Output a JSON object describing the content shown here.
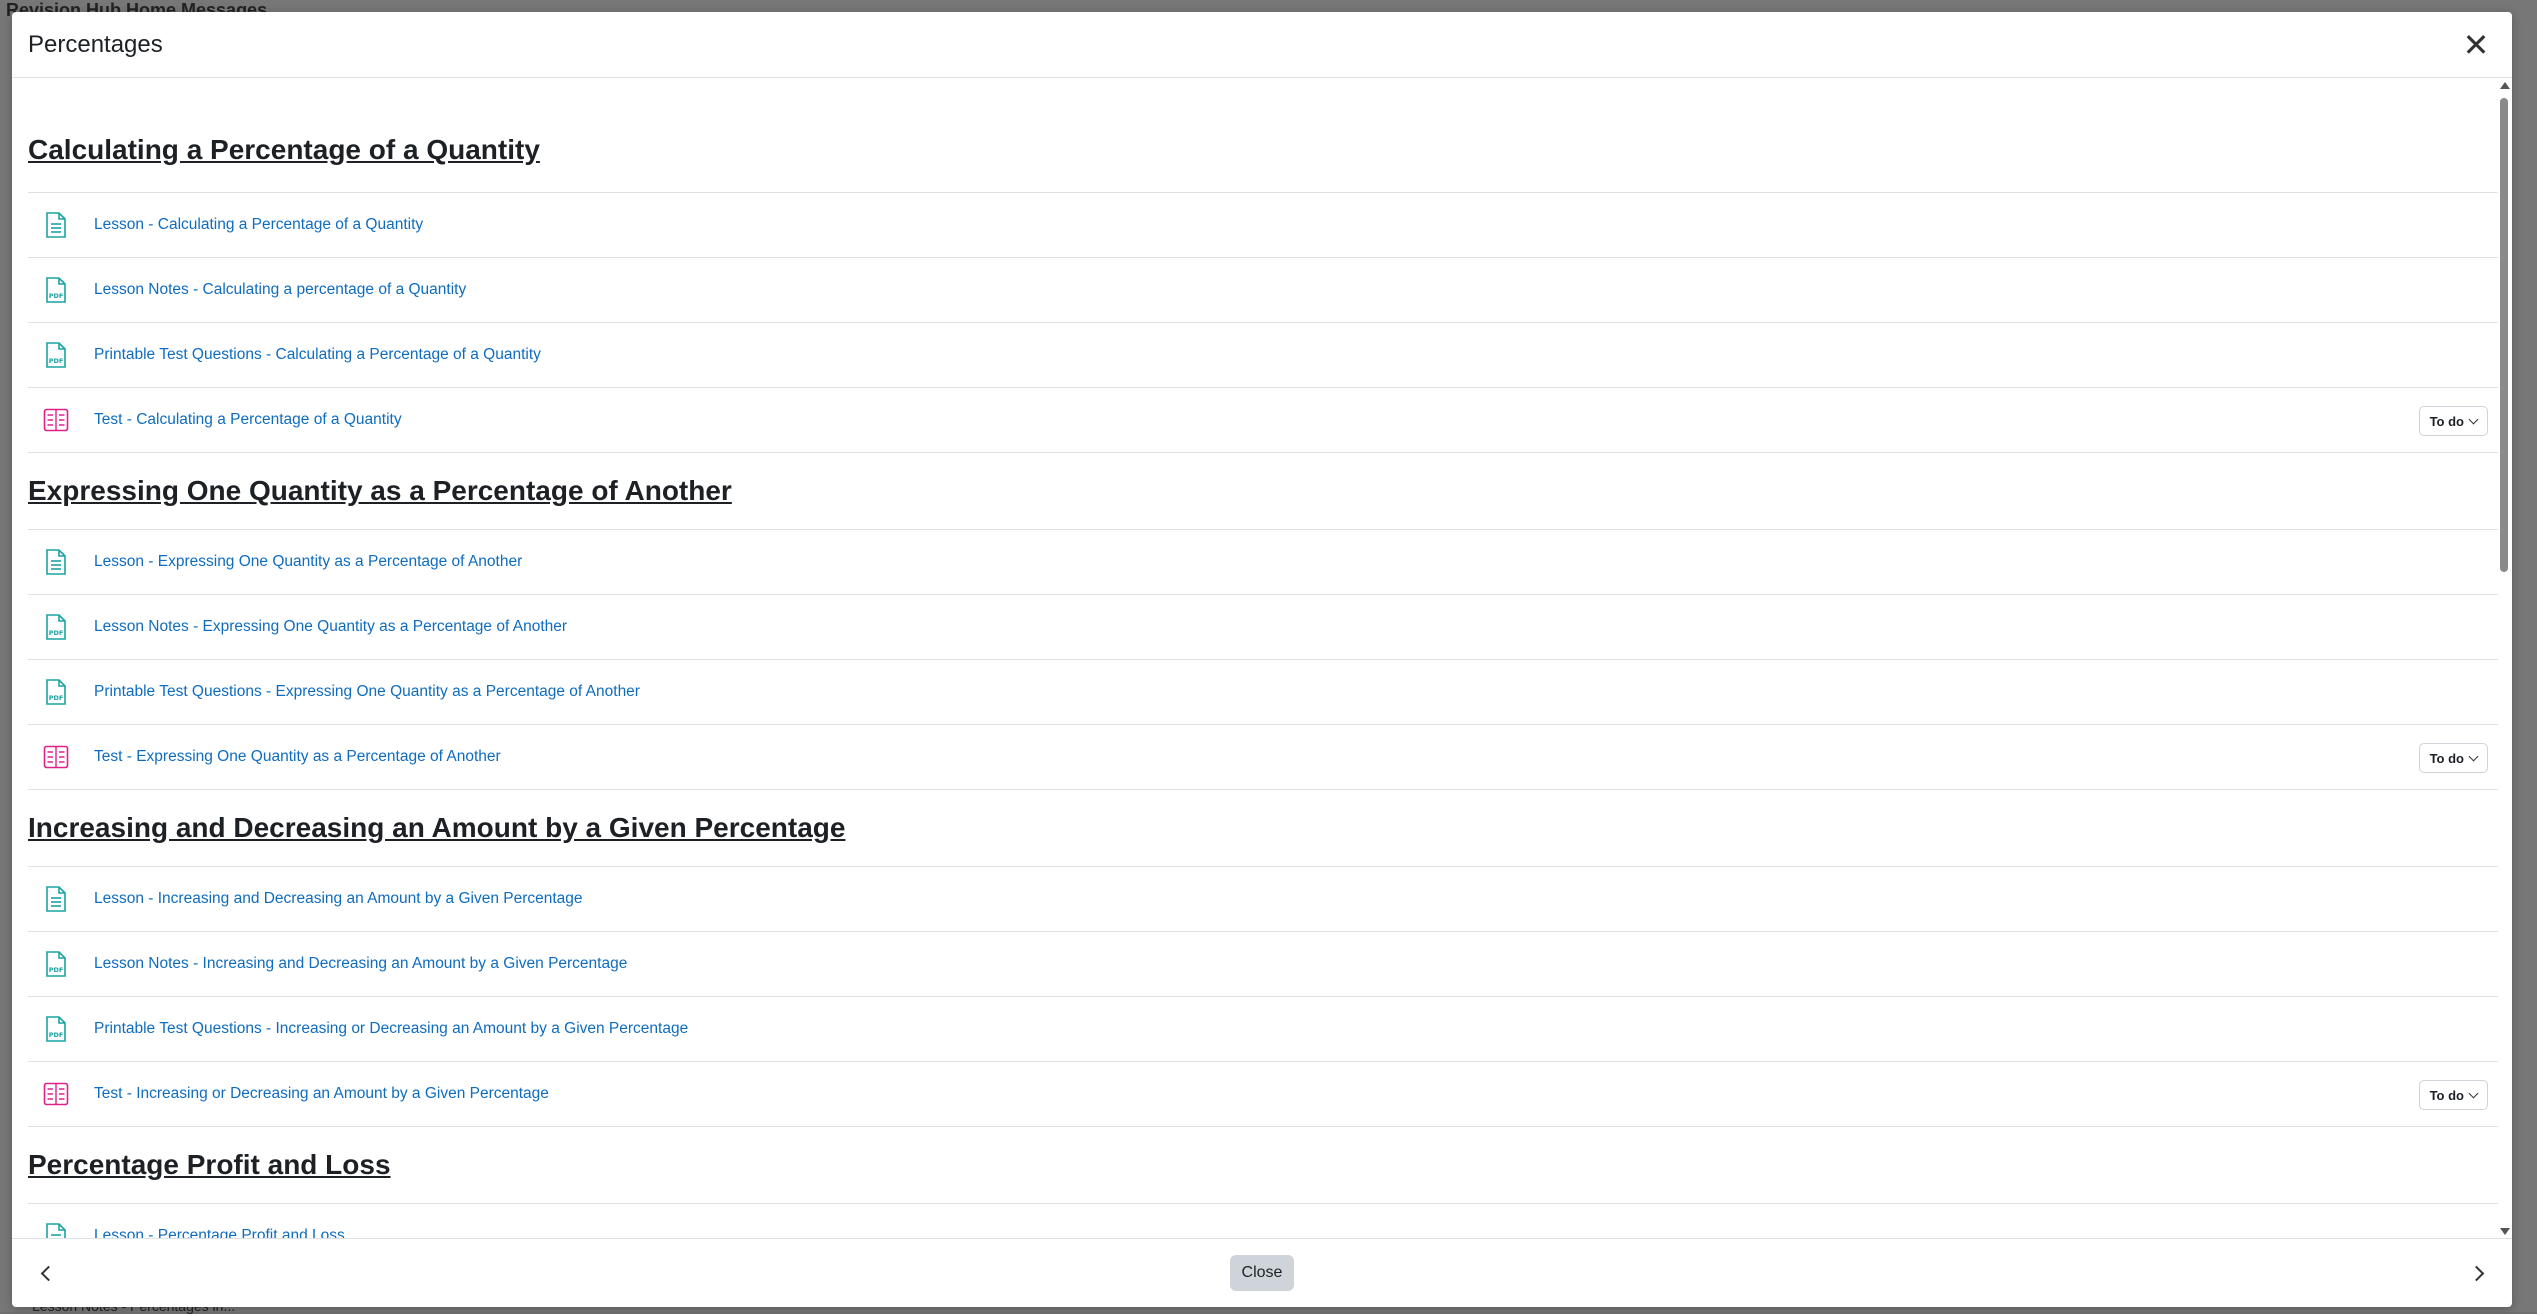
{
  "background": {
    "top_text": "Revision Hub    Home    Messages",
    "bottom_text": "Lesson Notes - Percentages in..."
  },
  "modal": {
    "title": "Percentages",
    "footer": {
      "close_label": "Close"
    }
  },
  "sections": [
    {
      "title": "Calculating a Percentage of a Quantity",
      "items": [
        {
          "type": "page",
          "label": "Lesson - Calculating a Percentage of a Quantity"
        },
        {
          "type": "pdf",
          "label": "Lesson Notes - Calculating a percentage of a Quantity"
        },
        {
          "type": "pdf",
          "label": "Printable Test Questions - Calculating a Percentage of a Quantity"
        },
        {
          "type": "quiz",
          "label": "Test - Calculating a Percentage of a Quantity",
          "status": "To do"
        }
      ]
    },
    {
      "title": "Expressing One Quantity as a Percentage of Another",
      "items": [
        {
          "type": "page",
          "label": "Lesson - Expressing One Quantity as a Percentage of Another"
        },
        {
          "type": "pdf",
          "label": "Lesson Notes - Expressing One Quantity as a Percentage of Another"
        },
        {
          "type": "pdf",
          "label": "Printable Test Questions - Expressing One Quantity as a Percentage of Another"
        },
        {
          "type": "quiz",
          "label": "Test - Expressing One Quantity as a Percentage of Another",
          "status": "To do"
        }
      ]
    },
    {
      "title": "Increasing and Decreasing an Amount by a Given Percentage",
      "items": [
        {
          "type": "page",
          "label": "Lesson - Increasing and Decreasing an Amount by a Given Percentage"
        },
        {
          "type": "pdf",
          "label": "Lesson Notes - Increasing and Decreasing an Amount by a Given Percentage"
        },
        {
          "type": "pdf",
          "label": "Printable Test Questions - Increasing or Decreasing an Amount by a Given Percentage"
        },
        {
          "type": "quiz",
          "label": "Test - Increasing or Decreasing an Amount by a Given Percentage",
          "status": "To do"
        }
      ]
    },
    {
      "title": "Percentage Profit and Loss",
      "items": [
        {
          "type": "page",
          "label": "Lesson - Percentage Profit and Loss"
        }
      ]
    }
  ],
  "colors": {
    "link": "#0f6cbf",
    "page_icon": "#1aa3a3",
    "pdf_icon": "#1aa3a3",
    "quiz_icon": "#e0218a"
  }
}
